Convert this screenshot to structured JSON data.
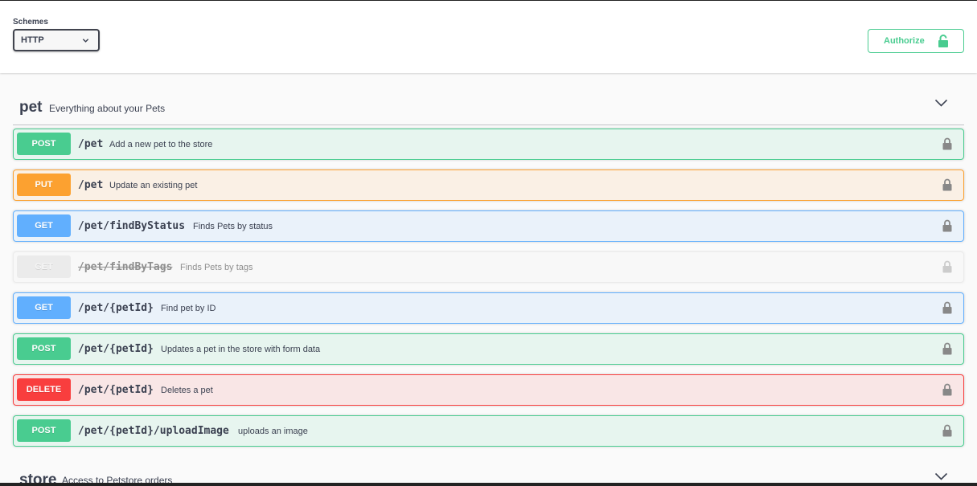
{
  "schemes": {
    "label": "Schemes",
    "selected": "HTTP"
  },
  "authorize": {
    "label": "Authorize",
    "color": "#49cc90"
  },
  "tags": [
    {
      "name": "pet",
      "description": "Everything about your Pets",
      "operations": [
        {
          "method": "POST",
          "path": "/pet",
          "summary": "Add a new pet to the store"
        },
        {
          "method": "PUT",
          "path": "/pet",
          "summary": "Update an existing pet"
        },
        {
          "method": "GET",
          "path": "/pet/findByStatus",
          "summary": "Finds Pets by status"
        },
        {
          "method": "GET",
          "path": "/pet/findByTags",
          "summary": "Finds Pets by tags",
          "deprecated": true
        },
        {
          "method": "GET",
          "path": "/pet/{petId}",
          "summary": "Find pet by ID"
        },
        {
          "method": "POST",
          "path": "/pet/{petId}",
          "summary": "Updates a pet in the store with form data"
        },
        {
          "method": "DELETE",
          "path": "/pet/{petId}",
          "summary": "Deletes a pet"
        },
        {
          "method": "POST",
          "path": "/pet/{petId}/uploadImage",
          "summary": "uploads an image"
        }
      ]
    },
    {
      "name": "store",
      "description": "Access to Petstore orders"
    }
  ],
  "method_colors": {
    "POST": "#49cc90",
    "PUT": "#fca130",
    "GET": "#61affe",
    "DELETE": "#f93e3e",
    "deprecated": "#ebebeb"
  }
}
